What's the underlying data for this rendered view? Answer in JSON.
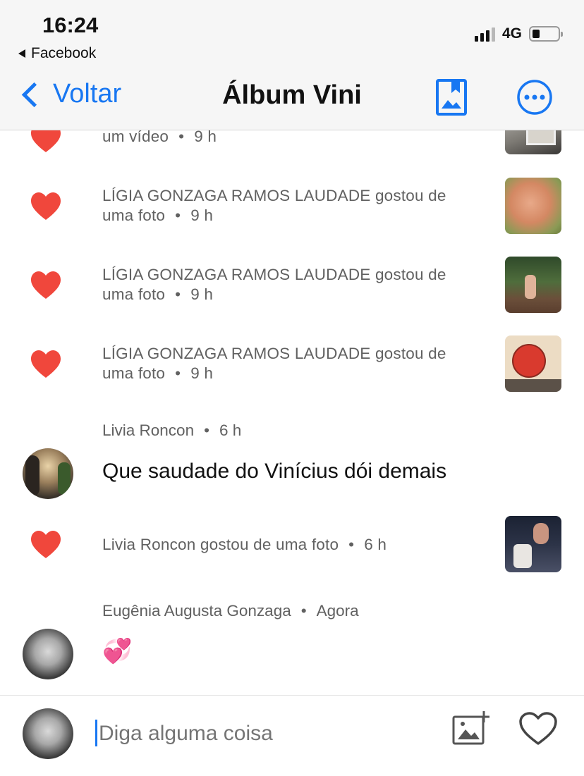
{
  "status_bar": {
    "time": "16:24",
    "back_app": "Facebook",
    "network": "4G"
  },
  "nav": {
    "back_label": "Voltar",
    "title": "Álbum Vini",
    "icons": [
      "album-icon",
      "more-icon"
    ],
    "accent_color": "#1877f2"
  },
  "feed": {
    "partial_item": {
      "text": "um vídeo",
      "time": "9 h"
    },
    "likes": [
      {
        "text": "LÍGIA GONZAGA RAMOS LAUDADE gostou de",
        "text2": "uma foto",
        "time": "9 h"
      },
      {
        "text": "LÍGIA GONZAGA RAMOS LAUDADE gostou de",
        "text2": "uma foto",
        "time": "9 h"
      },
      {
        "text": "LÍGIA GONZAGA RAMOS LAUDADE gostou de",
        "text2": "uma foto",
        "time": "9 h"
      }
    ],
    "comment1": {
      "name": "Livia Roncon",
      "time": "6 h",
      "text": "Que saudade do Vinícius dói demais"
    },
    "like_livia": {
      "text": "Livia Roncon gostou de uma foto",
      "time": "6 h"
    },
    "comment2": {
      "name": "Eugênia Augusta Gonzaga",
      "time": "Agora",
      "text": "💞"
    },
    "heart_color": "#f0473c"
  },
  "composer": {
    "placeholder": "Diga alguma coisa"
  }
}
